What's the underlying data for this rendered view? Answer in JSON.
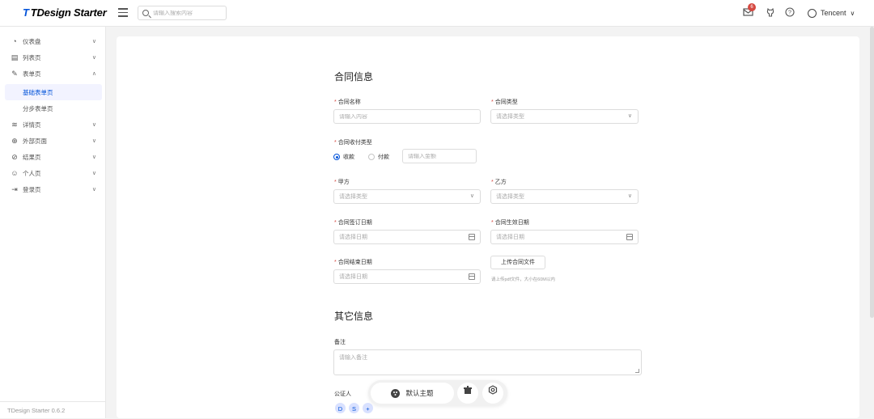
{
  "header": {
    "logo_text": "TDesign Starter",
    "search_placeholder": "请输入搜索内容",
    "notification_count": "6",
    "user_name": "Tencent"
  },
  "sidebar": {
    "items": [
      {
        "label": "仪表盘",
        "icon": "dashboard-icon"
      },
      {
        "label": "列表页",
        "icon": "list-icon"
      },
      {
        "label": "表单页",
        "icon": "edit-icon"
      },
      {
        "label": "详情页",
        "icon": "layers-icon"
      },
      {
        "label": "外部页面",
        "icon": "internet-icon"
      },
      {
        "label": "结果页",
        "icon": "check-circle-icon"
      },
      {
        "label": "个人页",
        "icon": "user-circle-icon"
      },
      {
        "label": "登录页",
        "icon": "login-icon"
      }
    ],
    "sub_items": [
      {
        "label": "基础表单页"
      },
      {
        "label": "分步表单页"
      }
    ],
    "version": "TDesign Starter 0.6.2"
  },
  "form": {
    "section1_title": "合同信息",
    "contract_name_label": "合同名称",
    "contract_name_placeholder": "请输入内容",
    "contract_type_label": "合同类型",
    "contract_type_placeholder": "请选择类型",
    "payment_type_label": "合同收付类型",
    "radio_receive": "收款",
    "radio_pay": "付款",
    "amount_placeholder": "请输入金额",
    "party_a_label": "甲方",
    "party_a_placeholder": "请选择类型",
    "party_b_label": "乙方",
    "party_b_placeholder": "请选择类型",
    "sign_date_label": "合同签订日期",
    "sign_date_placeholder": "请选择日期",
    "effective_date_label": "合同生效日期",
    "effective_date_placeholder": "请选择日期",
    "end_date_label": "合同结束日期",
    "end_date_placeholder": "请选择日期",
    "upload_label": "上传合同文件",
    "upload_tip": "请上传pdf文件，大小在60M以内",
    "section2_title": "其它信息",
    "remark_label": "备注",
    "remark_placeholder": "请输入备注",
    "notary_label": "公证人",
    "avatars": [
      "D",
      "S",
      "+"
    ]
  },
  "toolbar": {
    "theme_label": "默认主题"
  }
}
